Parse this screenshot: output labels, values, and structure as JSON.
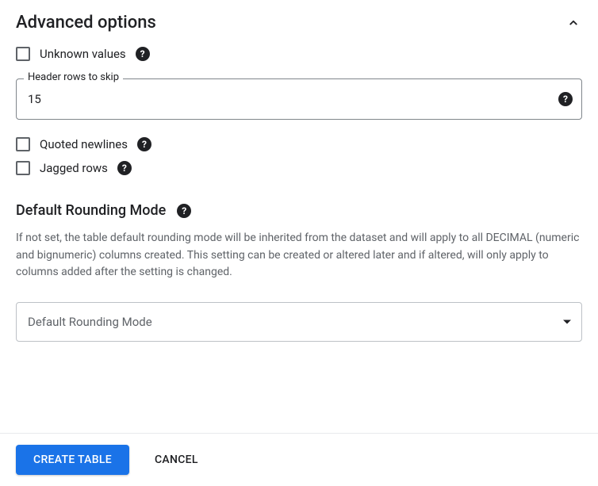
{
  "section": {
    "title": "Advanced options"
  },
  "checkboxes": {
    "unknown_values": "Unknown values",
    "quoted_newlines": "Quoted newlines",
    "jagged_rows": "Jagged rows"
  },
  "header_rows": {
    "label": "Header rows to skip",
    "value": "15"
  },
  "rounding": {
    "title": "Default Rounding Mode",
    "description": "If not set, the table default rounding mode will be inherited from the dataset and will apply to all DECIMAL (numeric and bignumeric) columns created. This setting can be created or altered later and if altered, will only apply to columns added after the setting is changed.",
    "selected": "Default Rounding Mode"
  },
  "footer": {
    "create": "CREATE TABLE",
    "cancel": "CANCEL"
  }
}
